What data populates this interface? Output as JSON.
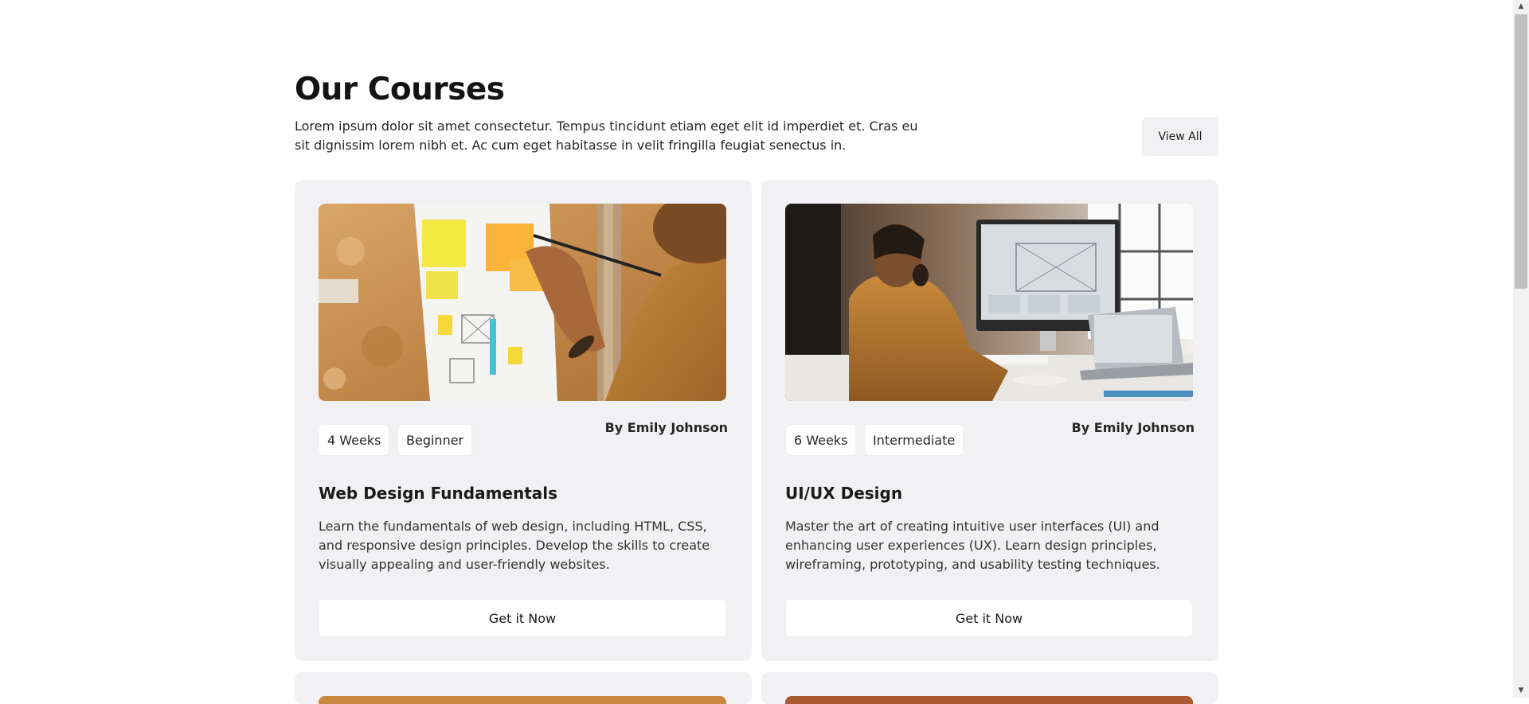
{
  "header": {
    "title": "Our Courses",
    "intro": "Lorem ipsum dolor sit amet consectetur. Tempus tincidunt etiam eget elit id imperdiet et. Cras eu sit dignissim lorem nibh et. Ac cum eget habitasse in velit fringilla feugiat senectus in.",
    "view_all_label": "View All"
  },
  "courses": [
    {
      "duration": "4 Weeks",
      "level": "Beginner",
      "author": "By Emily Johnson",
      "title": "Web Design Fundamentals",
      "description": "Learn the fundamentals of web design, including HTML, CSS, and responsive design principles. Develop the skills to create visually appealing and user-friendly websites.",
      "cta_label": "Get it Now"
    },
    {
      "duration": "6 Weeks",
      "level": "Intermediate",
      "author": "By Emily Johnson",
      "title": "UI/UX Design",
      "description": "Master the art of creating intuitive user interfaces (UI) and enhancing user experiences (UX). Learn design principles, wireframing, prototyping, and usability testing techniques.",
      "cta_label": "Get it Now"
    }
  ],
  "colors": {
    "card_background": "#f1f1f3",
    "button_background": "#ffffff",
    "page_background": "#ffffff"
  }
}
